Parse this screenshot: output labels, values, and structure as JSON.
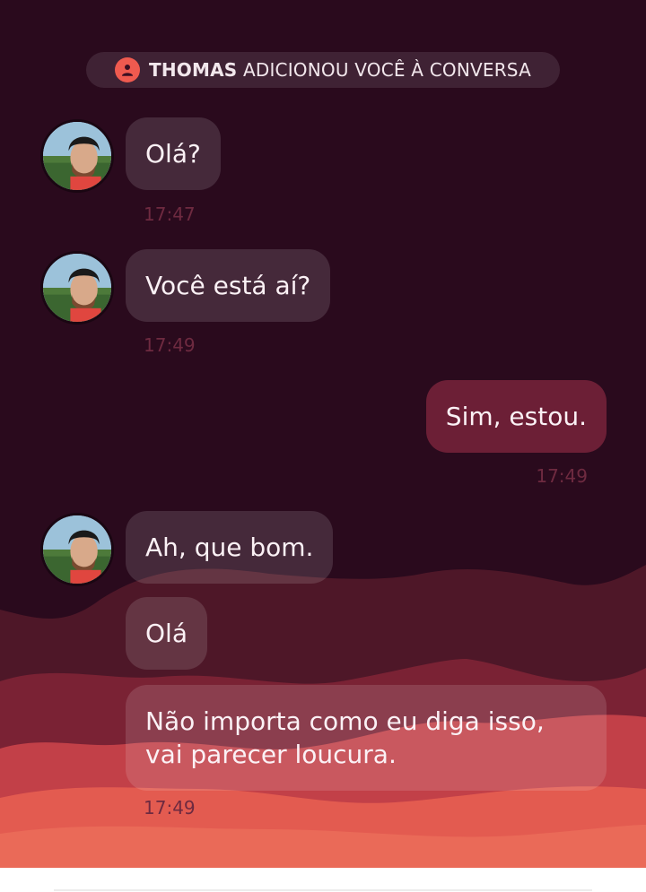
{
  "system_notice": {
    "name": "THOMAS",
    "text": " ADICIONOU VOCÊ À CONVERSA",
    "icon": "user-icon"
  },
  "contact": {
    "avatar": "avatar"
  },
  "messages": [
    {
      "direction": "in",
      "text": "Olá?",
      "time": "17:47"
    },
    {
      "direction": "in",
      "text": "Você está aí?",
      "time": "17:49"
    },
    {
      "direction": "out",
      "text": "Sim, estou.",
      "time": "17:49"
    },
    {
      "direction": "in",
      "text": "Ah, que bom."
    },
    {
      "direction": "in",
      "text": "Olá"
    },
    {
      "direction": "in",
      "lines": [
        "Não importa como eu diga isso,",
        "vai parecer loucura."
      ],
      "time": "17:49"
    }
  ],
  "colors": {
    "background": "#2a0a1d",
    "incoming_bubble": "#4a2234",
    "outgoing_bubble": "#6c1f36",
    "accent": "#ef5a4f",
    "timestamp": "#6e2a40"
  }
}
